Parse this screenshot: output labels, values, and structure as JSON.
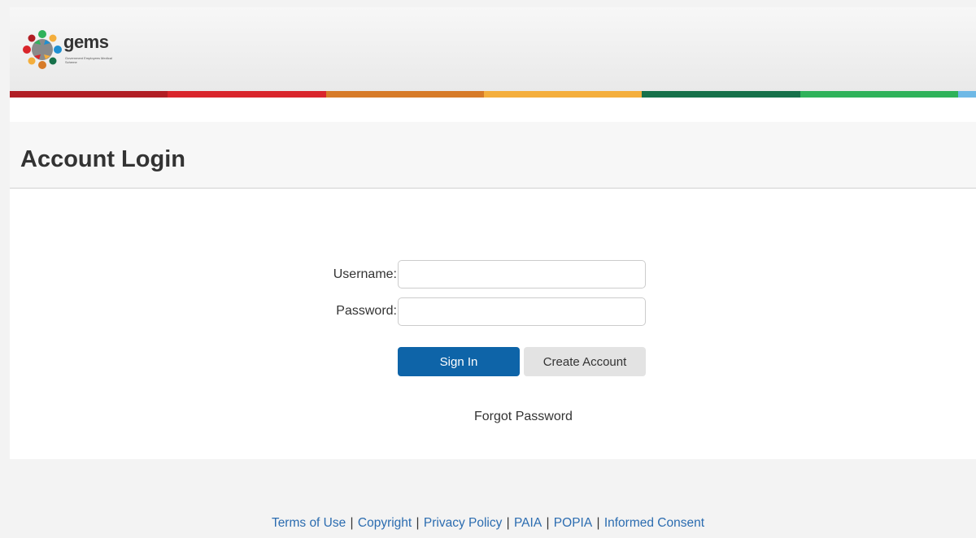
{
  "header": {
    "logo_text": "gems",
    "logo_subtitle": "Government Employees Medical Scheme",
    "stripe_colors": [
      "#b11e24",
      "#d9252b",
      "#d77b28",
      "#f4ae3c",
      "#16714a",
      "#2fb25a",
      "#6fb9e6"
    ]
  },
  "page": {
    "title": "Account Login"
  },
  "form": {
    "username_label": "Username:",
    "username_value": "",
    "password_label": "Password:",
    "password_value": "",
    "sign_in_label": "Sign In",
    "create_account_label": "Create Account",
    "forgot_password_label": "Forgot Password"
  },
  "footer": {
    "links": [
      "Terms of Use",
      "Copyright",
      "Privacy Policy",
      "PAIA",
      "POPIA",
      "Informed Consent"
    ],
    "separator": "|"
  },
  "colors": {
    "primary": "#0e64a8",
    "link": "#2b6cb0"
  }
}
